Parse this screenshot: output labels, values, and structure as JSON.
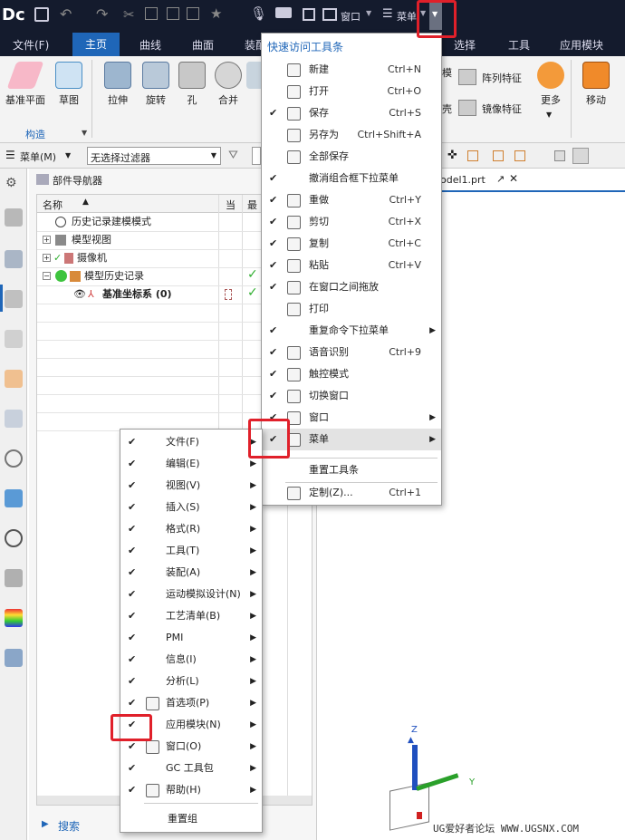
{
  "titlebar": {
    "logo": "Dc",
    "window_label": "窗口",
    "menu_label": "菜单"
  },
  "menubar": {
    "items": [
      "文件(F)",
      "主页",
      "曲线",
      "曲面",
      "装配",
      "选择",
      "工具",
      "应用模块"
    ]
  },
  "ribbon": {
    "buttons": [
      "基准平面",
      "草图",
      "拉伸",
      "旋转",
      "孔",
      "合并",
      "阵列特征",
      "镜像特征",
      "更多",
      "移动"
    ],
    "group_labels": [
      "构造"
    ]
  },
  "cmdbar": {
    "menu_button": "菜单(M)",
    "filter_value": "无选择过滤器"
  },
  "navigator": {
    "title": "部件导航器",
    "col_name": "名称",
    "col_current": "当",
    "col_latest": "最",
    "rows": [
      "历史记录建模模式",
      "模型视图",
      "摄像机",
      "模型历史记录",
      "基准坐标系 (0)"
    ],
    "search_label": "搜索"
  },
  "graphics": {
    "tab_label": "odel1.prt",
    "axis_z": "Z",
    "axis_y": "Y",
    "watermark": "UG爱好者论坛 WWW.UGSNX.COM"
  },
  "quick_menu": {
    "title": "快速访问工具条",
    "items": [
      {
        "label": "新建",
        "shortcut": "Ctrl+N",
        "checked": false,
        "icon": "new-icon"
      },
      {
        "label": "打开",
        "shortcut": "Ctrl+O",
        "checked": false,
        "icon": "open-icon"
      },
      {
        "label": "保存",
        "shortcut": "Ctrl+S",
        "checked": true,
        "icon": "save-icon"
      },
      {
        "label": "另存为",
        "shortcut": "Ctrl+Shift+A",
        "checked": false,
        "icon": "save-as-icon"
      },
      {
        "label": "全部保存",
        "shortcut": "",
        "checked": false,
        "icon": "save-all-icon"
      },
      {
        "label": "撤消组合框下拉菜单",
        "shortcut": "",
        "checked": true,
        "icon": ""
      },
      {
        "label": "重做",
        "shortcut": "Ctrl+Y",
        "checked": true,
        "icon": "redo-icon"
      },
      {
        "label": "剪切",
        "shortcut": "Ctrl+X",
        "checked": true,
        "icon": "cut-icon"
      },
      {
        "label": "复制",
        "shortcut": "Ctrl+C",
        "checked": true,
        "icon": "copy-icon"
      },
      {
        "label": "粘贴",
        "shortcut": "Ctrl+V",
        "checked": true,
        "icon": "paste-icon"
      },
      {
        "label": "在窗口之间拖放",
        "shortcut": "",
        "checked": true,
        "icon": "drag-drop-icon"
      },
      {
        "label": "打印",
        "shortcut": "",
        "checked": false,
        "icon": "print-icon"
      },
      {
        "label": "重复命令下拉菜单",
        "shortcut": "",
        "checked": true,
        "icon": "",
        "arrow": true
      },
      {
        "label": "语音识别",
        "shortcut": "Ctrl+9",
        "checked": true,
        "icon": "mic-icon"
      },
      {
        "label": "触控模式",
        "shortcut": "",
        "checked": true,
        "icon": "touch-icon"
      },
      {
        "label": "切换窗口",
        "shortcut": "",
        "checked": true,
        "icon": "switch-window-icon"
      },
      {
        "label": "窗口",
        "shortcut": "",
        "checked": true,
        "icon": "window-icon",
        "arrow": true
      },
      {
        "label": "菜单",
        "shortcut": "",
        "checked": true,
        "icon": "menu-icon",
        "arrow": true
      }
    ],
    "reset": "重置工具条",
    "customize": {
      "label": "定制(Z)...",
      "shortcut": "Ctrl+1"
    }
  },
  "sub_menu": {
    "items": [
      {
        "label": "文件(F)",
        "icon": ""
      },
      {
        "label": "编辑(E)",
        "icon": ""
      },
      {
        "label": "视图(V)",
        "icon": ""
      },
      {
        "label": "插入(S)",
        "icon": ""
      },
      {
        "label": "格式(R)",
        "icon": ""
      },
      {
        "label": "工具(T)",
        "icon": ""
      },
      {
        "label": "装配(A)",
        "icon": ""
      },
      {
        "label": "运动模拟设计(N)",
        "icon": ""
      },
      {
        "label": "工艺清单(B)",
        "icon": ""
      },
      {
        "label": "PMI",
        "icon": ""
      },
      {
        "label": "信息(I)",
        "icon": ""
      },
      {
        "label": "分析(L)",
        "icon": ""
      },
      {
        "label": "首选项(P)",
        "icon": "preferences-icon"
      },
      {
        "label": "应用模块(N)",
        "icon": ""
      },
      {
        "label": "窗口(O)",
        "icon": "window-icon"
      },
      {
        "label": "GC 工具包",
        "icon": ""
      },
      {
        "label": "帮助(H)",
        "icon": "help-icon"
      }
    ],
    "reset": "重置组"
  },
  "colors": {
    "accent": "#1f66b8",
    "highlight": "#e0202a",
    "dark": "#141b2d"
  }
}
